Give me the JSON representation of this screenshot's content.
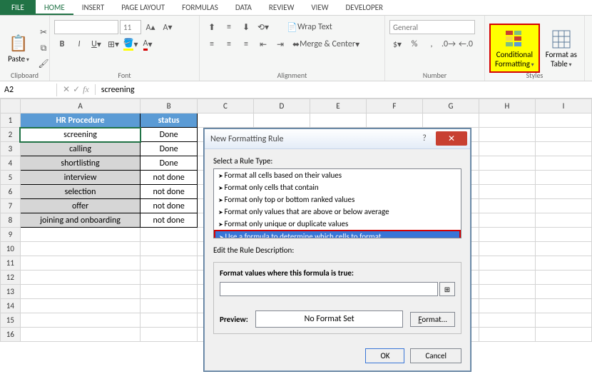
{
  "tabs": {
    "file": "FILE",
    "home": "HOME",
    "insert": "INSERT",
    "page_layout": "PAGE LAYOUT",
    "formulas": "FORMULAS",
    "data": "DATA",
    "review": "REVIEW",
    "view": "VIEW",
    "developer": "DEVELOPER"
  },
  "ribbon": {
    "clipboard": {
      "label": "Clipboard",
      "paste": "Paste"
    },
    "font": {
      "label": "Font",
      "size": "11"
    },
    "alignment": {
      "label": "Alignment",
      "wrap": "Wrap Text",
      "merge": "Merge & Center"
    },
    "number": {
      "label": "Number",
      "general": "General"
    },
    "styles": {
      "label": "Styles",
      "cf": "Conditional\nFormatting",
      "fat": "Format as\nTable"
    }
  },
  "fbar": {
    "name": "A2",
    "value": "screening"
  },
  "cols": [
    "A",
    "B",
    "C",
    "D",
    "E",
    "F",
    "G",
    "H",
    "I"
  ],
  "table": {
    "headers": {
      "a": "HR Procedure",
      "b": "status"
    },
    "rows": [
      {
        "a": "screening",
        "b": "Done"
      },
      {
        "a": "calling",
        "b": "Done"
      },
      {
        "a": "shortlisting",
        "b": "Done"
      },
      {
        "a": "interview",
        "b": "not done"
      },
      {
        "a": "selection",
        "b": "not done"
      },
      {
        "a": "offer",
        "b": "not done"
      },
      {
        "a": "joining and onboarding",
        "b": "not done"
      }
    ]
  },
  "dialog": {
    "title": "New Formatting Rule",
    "select_label": "Select a Rule Type:",
    "rules": [
      "Format all cells based on their values",
      "Format only cells that contain",
      "Format only top or bottom ranked values",
      "Format only values that are above or below average",
      "Format only unique or duplicate values",
      "Use a formula to determine which cells to format"
    ],
    "edit_label": "Edit the Rule Description:",
    "formula_label": "Format values where this formula is true:",
    "preview_label": "Preview:",
    "no_format": "No Format Set",
    "format_btn": "Format...",
    "ok": "OK",
    "cancel": "Cancel"
  }
}
